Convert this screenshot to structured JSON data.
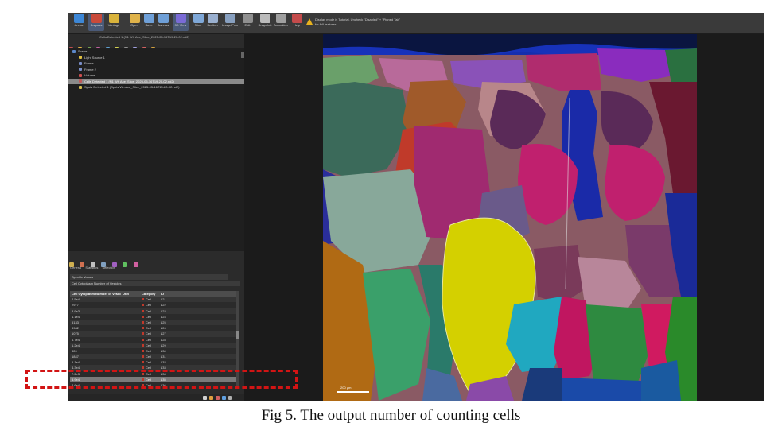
{
  "toolbar": {
    "buttons": [
      {
        "label": "Arena",
        "color": "#3d87d6",
        "active": false,
        "icon": "arena-icon"
      },
      {
        "label": "Surpass",
        "color": "#c94a3a",
        "active": true,
        "icon": "surpass-icon"
      },
      {
        "label": "Vantage",
        "color": "#d9b33b",
        "active": false,
        "icon": "vantage-icon"
      },
      {
        "label": "Open",
        "color": "#e0b34a",
        "active": false,
        "icon": "open-icon"
      },
      {
        "label": "Save",
        "color": "#6fa0d8",
        "active": false,
        "icon": "save-icon"
      },
      {
        "label": "Save as",
        "color": "#6fa0d8",
        "active": false,
        "icon": "save-as-icon"
      },
      {
        "label": "3D View",
        "color": "#7a6bd6",
        "active": true,
        "icon": "3d-view-icon"
      },
      {
        "label": "Slice",
        "color": "#7fa8d8",
        "active": false,
        "icon": "slice-icon"
      },
      {
        "label": "Section",
        "color": "#9ab0d0",
        "active": false,
        "icon": "section-icon"
      },
      {
        "label": "Image Proc",
        "color": "#88a0c0",
        "active": false,
        "icon": "image-proc-icon"
      },
      {
        "label": "Edit",
        "color": "#909090",
        "active": false,
        "icon": "edit-icon"
      },
      {
        "label": "Snapshot",
        "color": "#bcbcbc",
        "active": false,
        "icon": "snapshot-icon"
      },
      {
        "label": "Animation",
        "color": "#a0a0a0",
        "active": false,
        "icon": "animation-icon"
      },
      {
        "label": "Help",
        "color": "#c44b4b",
        "active": false,
        "icon": "help-icon"
      }
    ],
    "notice": "Display mode is Tutorial. Uncheck \"Disabled\" + \"Pinned Tab\" for full features."
  },
  "tree": {
    "title": "Cells Detected 1 (N1 Wh Ace_Slice_2025-05-16T19-20-02.nd2)",
    "items": [
      {
        "label": "Scene",
        "indent": 0,
        "selected": false,
        "color": "#5b87c9"
      },
      {
        "label": "Light Source 1",
        "indent": 1,
        "selected": false,
        "color": "#e0c040"
      },
      {
        "label": "Frame 1",
        "indent": 1,
        "selected": false,
        "color": "#7a8ec8"
      },
      {
        "label": "Frame 2",
        "indent": 1,
        "selected": false,
        "color": "#7a8ec8"
      },
      {
        "label": "Volume",
        "indent": 1,
        "selected": false,
        "color": "#d05050"
      },
      {
        "label": "Cells Detected 1 (N1 Wh Ace_Slice_2025-05-16T19-20-02.nd2)",
        "indent": 1,
        "selected": true,
        "color": "#c05858"
      },
      {
        "label": "Spots Detected 1 (Spots Wh Ace_Slice_2025-05-16T19-20-02.nd2)",
        "indent": 1,
        "selected": false,
        "color": "#d8c050"
      }
    ]
  },
  "properties": {
    "tabs": [
      "General",
      "Statistics",
      "Selection"
    ],
    "stats_mode": "Specific Values",
    "stat_name": "Cell Cytoplasm Number of Vesicles",
    "table": {
      "headers": [
        "Cell Cytoplasm Number of Vesicles",
        "Unit",
        "Category",
        "ID"
      ],
      "rows": [
        {
          "value": "2.5e4",
          "unit": "",
          "category": "Cell",
          "id": "121"
        },
        {
          "value": "2977",
          "unit": "",
          "category": "Cell",
          "id": "122"
        },
        {
          "value": "8.9e3",
          "unit": "",
          "category": "Cell",
          "id": "123"
        },
        {
          "value": "1.1e4",
          "unit": "",
          "category": "Cell",
          "id": "124"
        },
        {
          "value": "5133",
          "unit": "",
          "category": "Cell",
          "id": "125"
        },
        {
          "value": "3982",
          "unit": "",
          "category": "Cell",
          "id": "126"
        },
        {
          "value": "1075",
          "unit": "",
          "category": "Cell",
          "id": "127"
        },
        {
          "value": "6.7e4",
          "unit": "",
          "category": "Cell",
          "id": "128"
        },
        {
          "value": "1.2e4",
          "unit": "",
          "category": "Cell",
          "id": "129"
        },
        {
          "value": "820",
          "unit": "",
          "category": "Cell",
          "id": "130"
        },
        {
          "value": "1847",
          "unit": "",
          "category": "Cell",
          "id": "131"
        },
        {
          "value": "5.1e4",
          "unit": "",
          "category": "Cell",
          "id": "132"
        },
        {
          "value": "4.3e4",
          "unit": "",
          "category": "Cell",
          "id": "133"
        },
        {
          "value": "7.2e3",
          "unit": "",
          "category": "Cell",
          "id": "134"
        },
        {
          "value": "5.9e4",
          "unit": "",
          "category": "Cell",
          "id": "135"
        },
        {
          "value": "2.6e4",
          "unit": "",
          "category": "Cell",
          "id": "136"
        }
      ],
      "highlighted_row": 14
    }
  },
  "viewer": {
    "scale_label": "200 µm"
  },
  "caption": "Fig 5. The output number of counting cells",
  "colors": {
    "highlight_box": "#d21414",
    "selected_row": "#8a8a8a"
  }
}
